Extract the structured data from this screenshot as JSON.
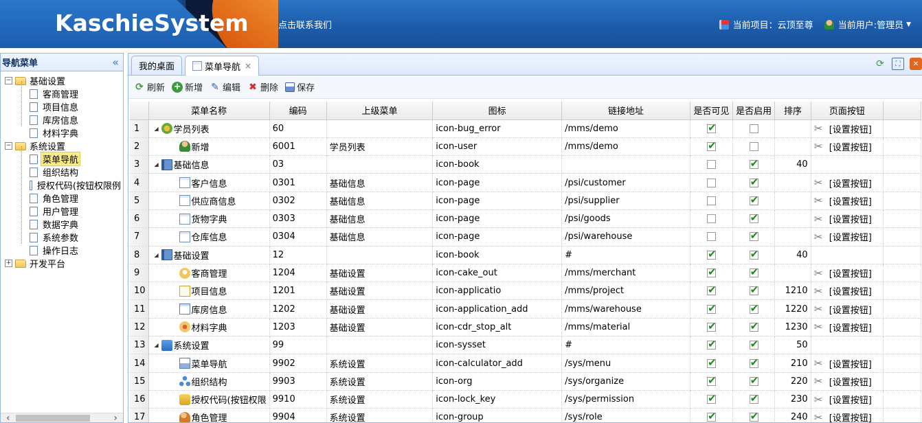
{
  "header": {
    "brand": "KaschieSystem",
    "contact": "点击联系我们",
    "project": "当前项目：云顶至尊",
    "user": "当前用户:管理员"
  },
  "sidebar": {
    "title": "导航菜单",
    "collapse": "«",
    "tree": [
      {
        "label": "基础设置",
        "type": "folder",
        "expand": "−"
      },
      {
        "label": "客商管理",
        "type": "doc"
      },
      {
        "label": "项目信息",
        "type": "doc"
      },
      {
        "label": "库房信息",
        "type": "doc"
      },
      {
        "label": "材料字典",
        "type": "doc"
      },
      {
        "label": "系统设置",
        "type": "folder",
        "expand": "−"
      },
      {
        "label": "菜单导航",
        "type": "doc",
        "selected": true
      },
      {
        "label": "组织结构",
        "type": "doc"
      },
      {
        "label": "授权代码(按钮权限例",
        "type": "doc"
      },
      {
        "label": "角色管理",
        "type": "doc"
      },
      {
        "label": "用户管理",
        "type": "doc"
      },
      {
        "label": "数据字典",
        "type": "doc"
      },
      {
        "label": "系统参数",
        "type": "doc"
      },
      {
        "label": "操作日志",
        "type": "doc"
      },
      {
        "label": "开发平台",
        "type": "folder",
        "expand": "+"
      }
    ]
  },
  "tabs": [
    {
      "label": "我的桌面",
      "active": false
    },
    {
      "label": "菜单导航",
      "active": true,
      "close": "×"
    }
  ],
  "toolbar": {
    "refresh": "刷新",
    "add": "新增",
    "edit": "编辑",
    "delete": "删除",
    "save": "保存"
  },
  "grid": {
    "columns": [
      "",
      "菜单名称",
      "编码",
      "上级菜单",
      "图标",
      "链接地址",
      "是否可见",
      "是否启用",
      "排序",
      "页面按钮"
    ],
    "button_text": "[设置按钮]",
    "rows": [
      {
        "n": "1",
        "name": "学员列表",
        "level": 0,
        "group": true,
        "icon": "i-bug",
        "code": "60",
        "parent": "",
        "iconName": "icon-bug_error",
        "url": "/mms/demo",
        "visible": true,
        "enabled": false,
        "sort": "",
        "btn": true
      },
      {
        "n": "2",
        "name": "新增",
        "level": 1,
        "group": false,
        "icon": "i-user",
        "code": "6001",
        "parent": "学员列表",
        "iconName": "icon-user",
        "url": "/mms/demo",
        "visible": true,
        "enabled": false,
        "sort": "",
        "btn": true
      },
      {
        "n": "3",
        "name": "基础信息",
        "level": 0,
        "group": true,
        "icon": "i-book",
        "code": "03",
        "parent": "",
        "iconName": "icon-book",
        "url": "",
        "visible": false,
        "enabled": true,
        "sort": "40",
        "btn": false
      },
      {
        "n": "4",
        "name": "客户信息",
        "level": 1,
        "group": false,
        "icon": "i-page",
        "code": "0301",
        "parent": "基础信息",
        "iconName": "icon-page",
        "url": "/psi/customer",
        "visible": false,
        "enabled": true,
        "sort": "",
        "btn": true
      },
      {
        "n": "5",
        "name": "供应商信息",
        "level": 1,
        "group": false,
        "icon": "i-page",
        "code": "0302",
        "parent": "基础信息",
        "iconName": "icon-page",
        "url": "/psi/supplier",
        "visible": false,
        "enabled": true,
        "sort": "",
        "btn": true
      },
      {
        "n": "6",
        "name": "货物字典",
        "level": 1,
        "group": false,
        "icon": "i-page",
        "code": "0303",
        "parent": "基础信息",
        "iconName": "icon-page",
        "url": "/psi/goods",
        "visible": false,
        "enabled": true,
        "sort": "",
        "btn": true
      },
      {
        "n": "7",
        "name": "仓库信息",
        "level": 1,
        "group": false,
        "icon": "i-page",
        "code": "0304",
        "parent": "基础信息",
        "iconName": "icon-page",
        "url": "/psi/warehouse",
        "visible": false,
        "enabled": true,
        "sort": "",
        "btn": true
      },
      {
        "n": "8",
        "name": "基础设置",
        "level": 0,
        "group": true,
        "icon": "i-book",
        "code": "12",
        "parent": "",
        "iconName": "icon-book",
        "url": "#",
        "visible": true,
        "enabled": true,
        "sort": "40",
        "btn": false
      },
      {
        "n": "9",
        "name": "客商管理",
        "level": 1,
        "group": false,
        "icon": "i-cake",
        "code": "1204",
        "parent": "基础设置",
        "iconName": "icon-cake_out",
        "url": "/mms/merchant",
        "visible": true,
        "enabled": true,
        "sort": "",
        "btn": true
      },
      {
        "n": "10",
        "name": "项目信息",
        "level": 1,
        "group": false,
        "icon": "i-app",
        "code": "1201",
        "parent": "基础设置",
        "iconName": "icon-applicatio",
        "url": "/mms/project",
        "visible": true,
        "enabled": true,
        "sort": "1210",
        "btn": true
      },
      {
        "n": "11",
        "name": "库房信息",
        "level": 1,
        "group": false,
        "icon": "i-appadd",
        "code": "1202",
        "parent": "基础设置",
        "iconName": "icon-application_add",
        "url": "/mms/warehouse",
        "visible": true,
        "enabled": true,
        "sort": "1220",
        "btn": true
      },
      {
        "n": "12",
        "name": "材料字典",
        "level": 1,
        "group": false,
        "icon": "i-cdr",
        "code": "1203",
        "parent": "基础设置",
        "iconName": "icon-cdr_stop_alt",
        "url": "/mms/material",
        "visible": true,
        "enabled": true,
        "sort": "1230",
        "btn": true
      },
      {
        "n": "13",
        "name": "系统设置",
        "level": 0,
        "group": true,
        "icon": "i-sys",
        "code": "99",
        "parent": "",
        "iconName": "icon-sysset",
        "url": "#",
        "visible": true,
        "enabled": true,
        "sort": "50",
        "btn": false
      },
      {
        "n": "14",
        "name": "菜单导航",
        "level": 1,
        "group": false,
        "icon": "i-calc",
        "code": "9902",
        "parent": "系统设置",
        "iconName": "icon-calculator_add",
        "url": "/sys/menu",
        "visible": true,
        "enabled": true,
        "sort": "210",
        "btn": true
      },
      {
        "n": "15",
        "name": "组织结构",
        "level": 1,
        "group": false,
        "icon": "i-org",
        "code": "9903",
        "parent": "系统设置",
        "iconName": "icon-org",
        "url": "/sys/organize",
        "visible": true,
        "enabled": true,
        "sort": "220",
        "btn": true
      },
      {
        "n": "16",
        "name": "授权代码(按钮权限",
        "level": 1,
        "group": false,
        "icon": "i-lock",
        "code": "9910",
        "parent": "系统设置",
        "iconName": "icon-lock_key",
        "url": "/sys/permission",
        "visible": true,
        "enabled": true,
        "sort": "230",
        "btn": true
      },
      {
        "n": "17",
        "name": "角色管理",
        "level": 1,
        "group": false,
        "icon": "i-group",
        "code": "9904",
        "parent": "系统设置",
        "iconName": "icon-group",
        "url": "/sys/role",
        "visible": true,
        "enabled": true,
        "sort": "240",
        "btn": true
      }
    ]
  }
}
